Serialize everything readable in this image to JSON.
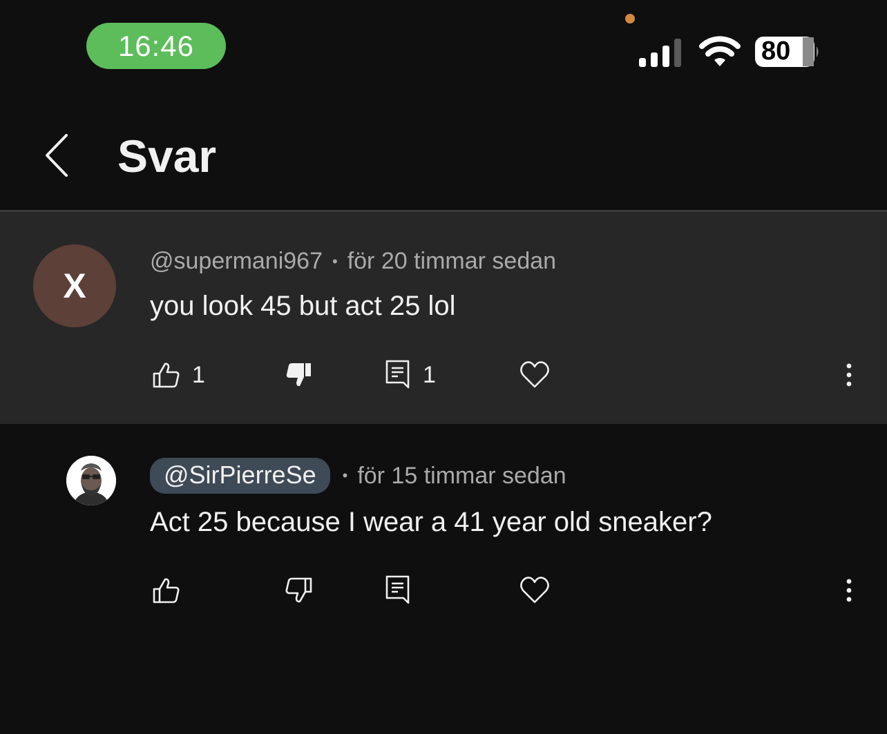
{
  "status_bar": {
    "time": "16:46",
    "battery": "80",
    "icons": [
      "cellular-signal-icon",
      "wifi-icon",
      "battery-icon"
    ]
  },
  "header": {
    "title": "Svar",
    "back_icon": "chevron-left-icon"
  },
  "parent_comment": {
    "avatar_letter": "X",
    "avatar_color": "#5d4037",
    "author": "@supermani967",
    "separator": "•",
    "timestamp": "för 20 timmar sedan",
    "text": "you look 45 but act 25 lol",
    "likes": "1",
    "replies": "1",
    "disliked": true
  },
  "reply": {
    "author": "@SirPierreSe",
    "separator": "•",
    "timestamp": "för 15 timmar sedan",
    "text": "Act 25 because I wear a 41 year old sneaker?"
  },
  "colors": {
    "background": "#0f0f0f",
    "highlight": "#272727",
    "time_pill": "#5cbd5a",
    "author_chip": "#3f4a57",
    "secondary_text": "#aaaaaa"
  }
}
